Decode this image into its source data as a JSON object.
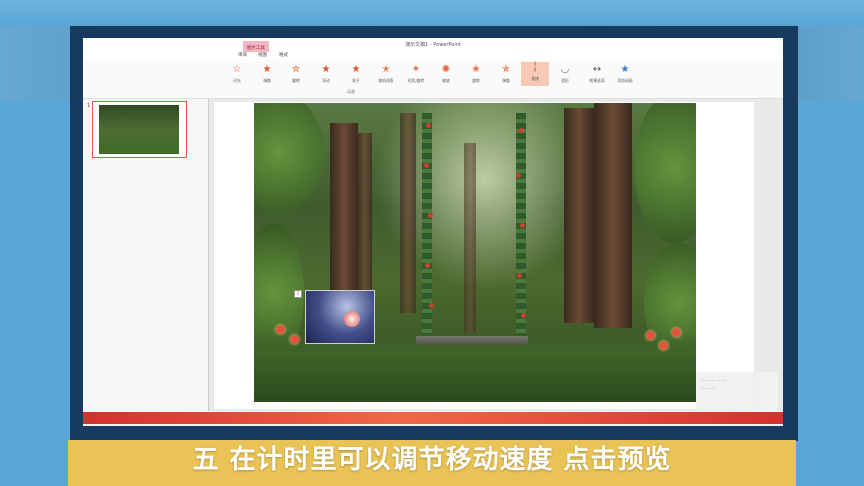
{
  "window": {
    "title": "演示文稿1 - PowerPoint",
    "context_tab": "图片工具",
    "tabs": [
      "审阅",
      "视图",
      "格式"
    ]
  },
  "ribbon": {
    "effects": [
      {
        "label": "闪光",
        "selected": false
      },
      {
        "label": "弹跳",
        "selected": false
      },
      {
        "label": "翻转",
        "selected": false
      },
      {
        "label": "浮动",
        "selected": false
      },
      {
        "label": "轮子",
        "selected": false
      },
      {
        "label": "随机线条",
        "selected": false
      },
      {
        "label": "形状/旋转",
        "selected": false
      },
      {
        "label": "缩放",
        "selected": false
      },
      {
        "label": "旋转",
        "selected": false
      },
      {
        "label": "弹跳",
        "selected": false
      },
      {
        "label": "直线",
        "selected": true
      },
      {
        "label": "弧形",
        "selected": false
      }
    ],
    "effect_options_label": "效果选项",
    "add_animation_label": "添加动画",
    "group_label": "动画"
  },
  "thumbnails": {
    "slide_number": "1"
  },
  "caption": {
    "text": "五  在计时里可以调节移动速度 点击预览"
  },
  "colors": {
    "caption_bg": "#e9c355",
    "accent": "#e05a2a",
    "status_bar": "#d33030"
  }
}
